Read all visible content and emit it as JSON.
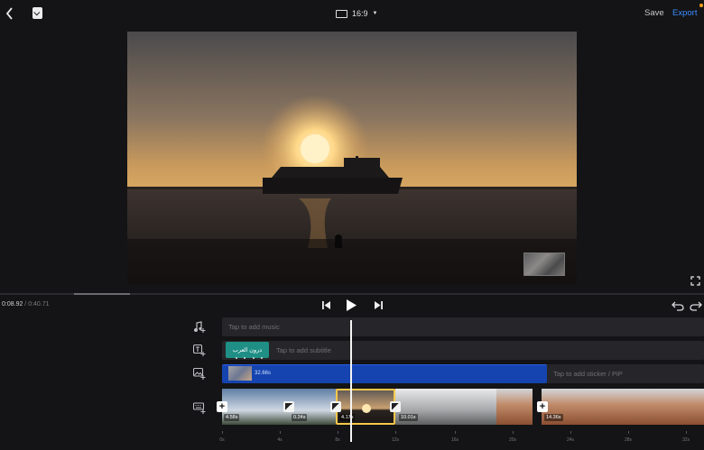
{
  "topbar": {
    "aspect_ratio": "16:9",
    "save_label": "Save",
    "export_label": "Export",
    "icons": {
      "back": "back-arrow-icon",
      "doc": "project-doc-icon",
      "ratio": "aspect-ratio-icon"
    }
  },
  "colors": {
    "accent": "#3a8cff",
    "selection": "#f5c84a",
    "subtitle_clip": "#1f8f86",
    "pip_track": "#1544b0",
    "export_dot": "#ff9f1a"
  },
  "playback": {
    "current_time": "0:08.92",
    "separator": " / ",
    "duration": "0:40.71",
    "progress_fraction": 0.22
  },
  "tracks": {
    "music": {
      "hint": "Tap to add music",
      "icon": "music-add-icon"
    },
    "subtitle": {
      "hint": "Tap to add subtitle",
      "clip_text": "درون العرب",
      "icon": "text-add-icon"
    },
    "pip": {
      "hint": "Tap to add sticker / PiP",
      "clip_duration": "32.66s",
      "icon": "image-add-icon"
    },
    "video": {
      "icon": "keyboard-icon",
      "clip_labels": [
        "4.58s",
        "0.24s",
        "4.17s",
        "10.01s",
        "14.36s"
      ]
    }
  },
  "ruler": {
    "labels": [
      "0s",
      "4s",
      "8s",
      "12s",
      "16s",
      "20s",
      "24s",
      "28s",
      "32s"
    ]
  }
}
